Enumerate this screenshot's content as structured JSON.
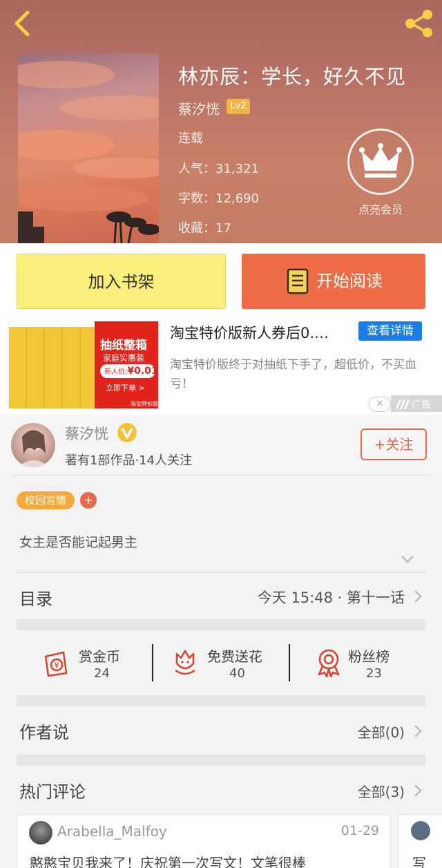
{
  "header": {
    "book_title": "林亦辰：学长，好久不见",
    "author": "蔡汐恍",
    "level": "Lv2",
    "status": "连载",
    "popularity_label": "人气：",
    "popularity": "31,321",
    "word_count_label": "字数：",
    "word_count": "12,690",
    "favorites_label": "收藏：",
    "favorites": "17",
    "vip_label": "点亮会员"
  },
  "actions": {
    "add_shelf": "加入书架",
    "start_reading": "开始阅读"
  },
  "ad": {
    "title": "淘宝特价版新人券后0.…",
    "details_button": "查看详情",
    "description": "淘宝特价版终于对抽纸下手了，超低价，不买血亏！",
    "close_symbol": "✕",
    "tag": "广告",
    "image_headline": "抽纸整箱",
    "image_sub": "家庭实惠装",
    "image_price_label": "新人价:",
    "image_price": "¥0.01",
    "image_cta": "立即下单 >",
    "image_brand": "淘宝特价版"
  },
  "author_section": {
    "name": "蔡汐恍",
    "stats": "著有1部作品·14人关注",
    "follow": "+关注"
  },
  "tags": {
    "primary": "校园言情",
    "add": "+"
  },
  "description": "女主是否能记起男主",
  "toc": {
    "label": "目录",
    "latest": "今天  15:48  ·  第十一话"
  },
  "gifts": [
    {
      "label": "赏金币",
      "count": "24"
    },
    {
      "label": "免费送花",
      "count": "40"
    },
    {
      "label": "粉丝榜",
      "count": "23"
    }
  ],
  "author_says": {
    "title": "作者说",
    "link": "全部(0)"
  },
  "hot_comments": {
    "title": "热门评论",
    "link": "全部(3)"
  },
  "comments": [
    {
      "user": "Arabella_Malfoy",
      "date": "01-29",
      "text": "憨憨宝贝我来了！庆祝第一次写文！文笔很棒"
    },
    {
      "text": "写"
    }
  ],
  "colors": {
    "accent_orange": "#ee6c45",
    "shelf_yellow": "#fbef7e",
    "tag_orange": "#f5a93d",
    "ad_blue": "#1a7ee6"
  }
}
